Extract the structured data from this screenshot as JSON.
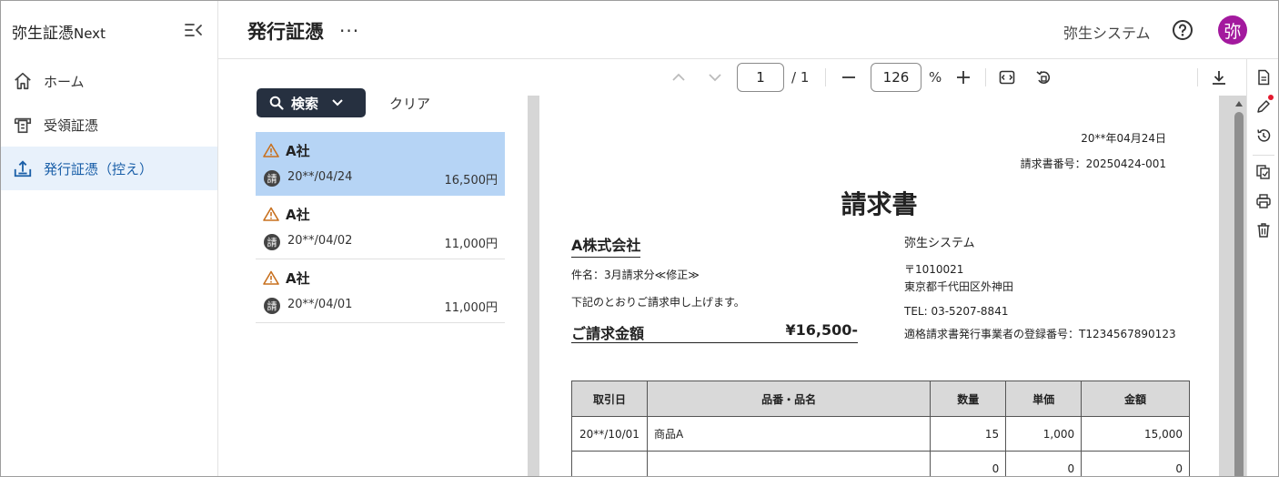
{
  "app": {
    "brand": "弥生証憑",
    "brand_suffix": "Next"
  },
  "sidebar": {
    "items": [
      {
        "label": "ホーム",
        "icon": "home-icon"
      },
      {
        "label": "受領証憑",
        "icon": "inbox-receipt-icon"
      },
      {
        "label": "発行証憑（控え）",
        "icon": "upload-receipt-icon"
      }
    ],
    "active_index": 2
  },
  "header": {
    "title": "発行証憑",
    "more": "···",
    "org": "弥生システム",
    "avatar": "弥"
  },
  "list": {
    "search_label": "検索",
    "clear_label": "クリア",
    "items": [
      {
        "partner": "A社",
        "kind": "請",
        "date": "20**/04/24",
        "amount": "16,500円"
      },
      {
        "partner": "A社",
        "kind": "請",
        "date": "20**/04/02",
        "amount": "11,000円"
      },
      {
        "partner": "A社",
        "kind": "請",
        "date": "20**/04/01",
        "amount": "11,000円"
      }
    ],
    "selected_index": 0
  },
  "viewer": {
    "page_current": "1",
    "page_total": "/ 1",
    "zoom": "126",
    "zoom_unit": "%"
  },
  "invoice": {
    "date": "20**年04月24日",
    "number": "請求書番号：20250424-001",
    "title": "請求書",
    "recipient": "A株式会社",
    "subject": "件名：3月請求分≪修正≫",
    "intro": "下記のとおりご請求申し上げます。",
    "total_label": "ご請求金額",
    "total_value": "¥16,500-",
    "issuer_name": "弥生システム",
    "issuer_postal": "〒1010021",
    "issuer_address": "東京都千代田区外神田",
    "issuer_tel": "TEL: 03-5207-8841",
    "issuer_reg": "適格請求書発行事業者の登録番号：T1234567890123",
    "columns": [
      "取引日",
      "品番・品名",
      "数量",
      "単価",
      "金額"
    ],
    "rows": [
      {
        "date": "20**/10/01",
        "item": "商品A",
        "qty": "15",
        "price": "1,000",
        "amount": "15,000"
      },
      {
        "date": "",
        "item": "",
        "qty": "0",
        "price": "0",
        "amount": "0"
      }
    ]
  }
}
